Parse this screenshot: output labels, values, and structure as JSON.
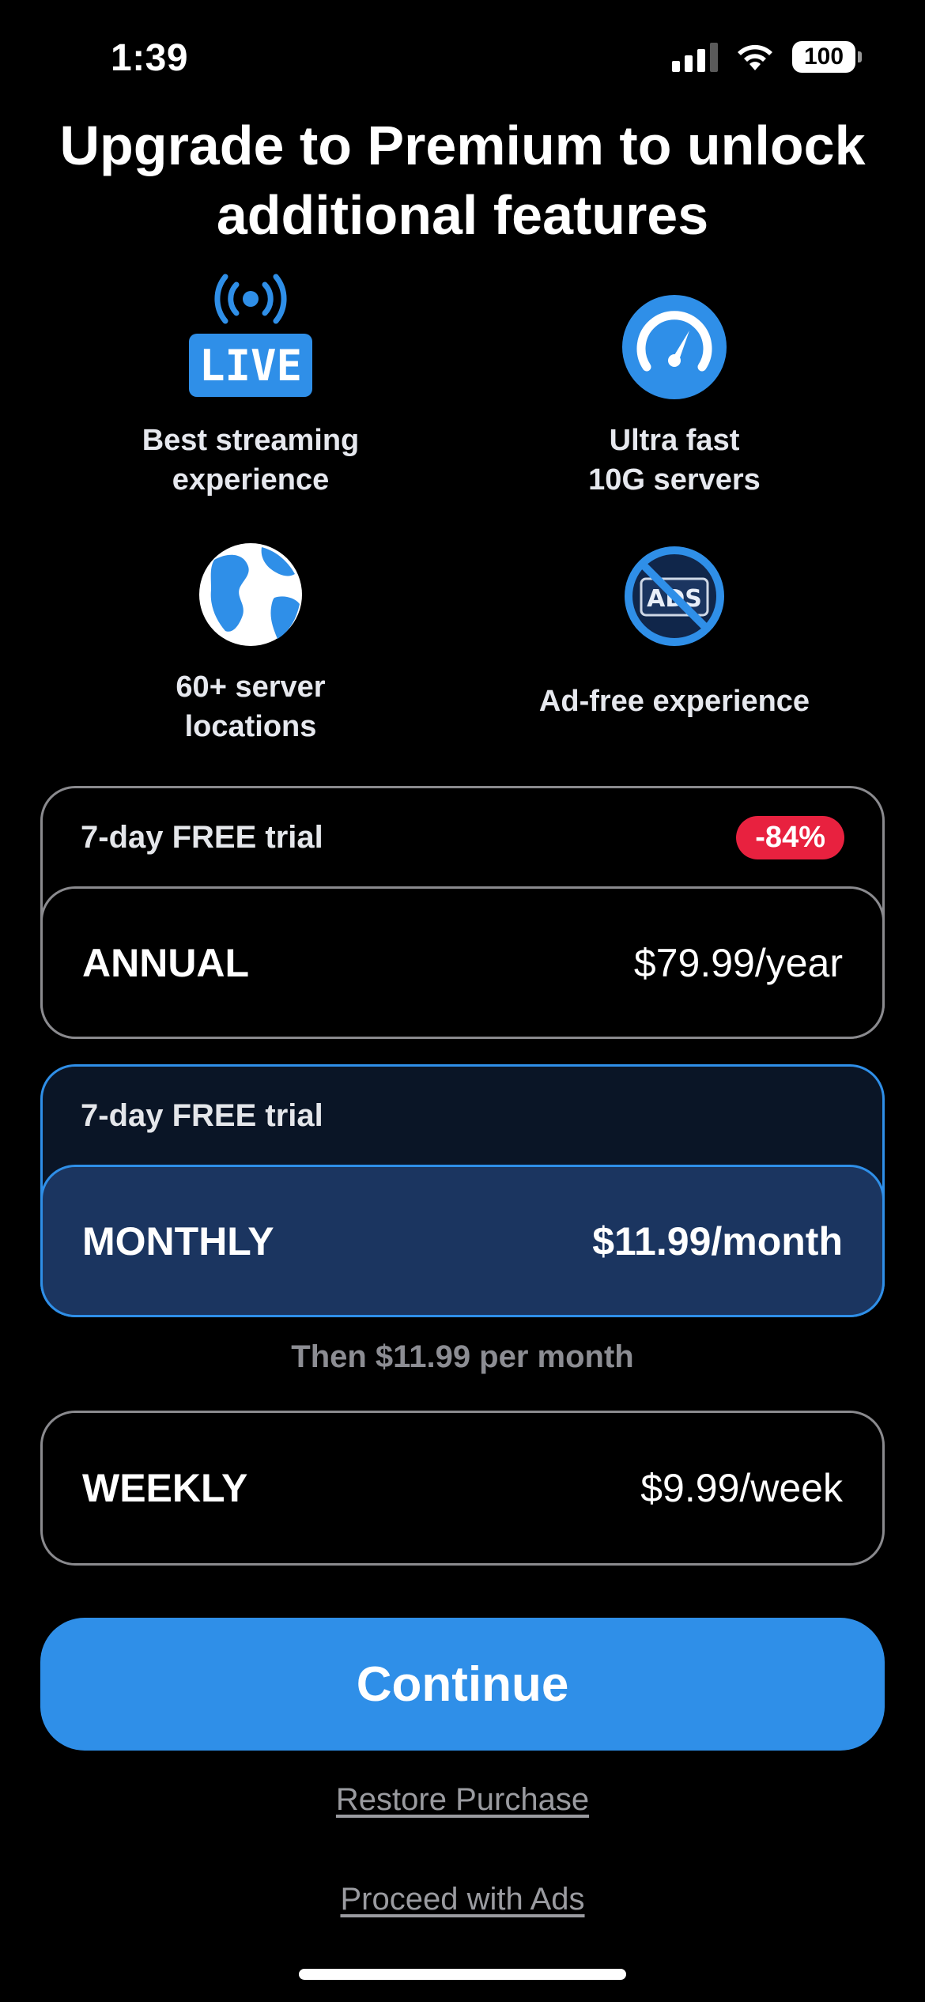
{
  "status_bar": {
    "time": "1:39",
    "battery": "100"
  },
  "title": "Upgrade to Premium to unlock additional features",
  "features": [
    {
      "icon": "live-broadcast-icon",
      "label": "Best streaming\nexperience"
    },
    {
      "icon": "speedometer-icon",
      "label": "Ultra fast\n10G servers"
    },
    {
      "icon": "globe-icon",
      "label": "60+ server\nlocations"
    },
    {
      "icon": "no-ads-icon",
      "label": "Ad-free experience"
    }
  ],
  "icon_text": {
    "live": "LIVE",
    "ads": "ADS"
  },
  "plans": {
    "annual": {
      "trial": "7-day FREE trial",
      "badge": "-84%",
      "name": "ANNUAL",
      "price": "$79.99/year"
    },
    "monthly": {
      "trial": "7-day FREE trial",
      "name": "MONTHLY",
      "price": "$11.99/month",
      "then": "Then $11.99 per month"
    },
    "weekly": {
      "name": "WEEKLY",
      "price": "$9.99/week"
    }
  },
  "continue_label": "Continue",
  "restore_label": "Restore Purchase",
  "proceed_label": "Proceed with Ads",
  "colors": {
    "accent": "#2f8fe8",
    "badge": "#e8213f",
    "selected_bg": "#1b3560"
  }
}
